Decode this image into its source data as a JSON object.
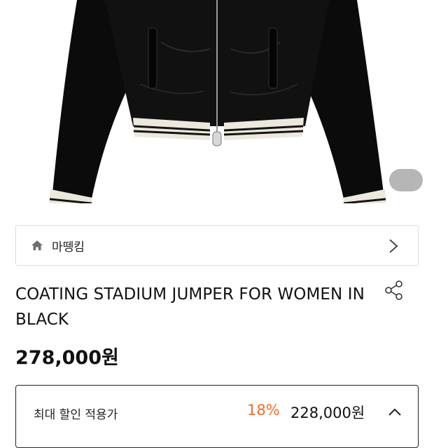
{
  "product": {
    "image_alt": "black stadium jumper with striped rib cuffs",
    "brand_name": "마뗑킴",
    "title": "COATING STADIUM JUMPER FOR WOMEN IN BLACK",
    "price": "278,000원"
  },
  "discount": {
    "label": "최대 할인 적용가",
    "percent": "18%",
    "price": "228,000원"
  },
  "icons": {
    "home": "home-icon",
    "chevron": "chevron-right-icon",
    "share": "share-icon",
    "collapse": "chevron-up-icon"
  },
  "colors": {
    "discount_accent": "#f26c2c",
    "border": "#dcdcdc"
  }
}
